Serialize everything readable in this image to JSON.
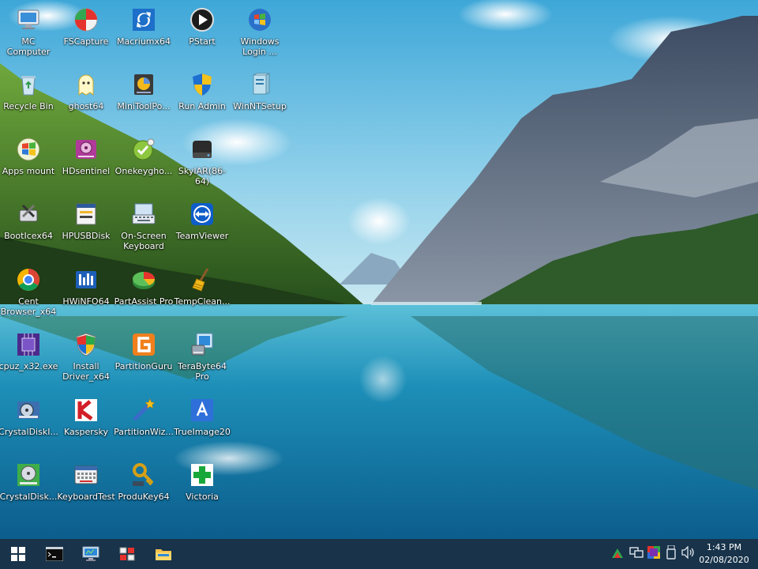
{
  "desktop": {
    "icons": [
      {
        "label": "MC\nComputer"
      },
      {
        "label": "FSCapture"
      },
      {
        "label": "Macriumx64"
      },
      {
        "label": "PStart"
      },
      {
        "label": "Windows\nLogin ..."
      },
      {
        "label": "Recycle Bin"
      },
      {
        "label": "ghost64"
      },
      {
        "label": "MiniToolPo..."
      },
      {
        "label": "Run Admin"
      },
      {
        "label": "WinNTSetup"
      },
      {
        "label": "Apps mount"
      },
      {
        "label": "HDsentinel"
      },
      {
        "label": "Onekeygho..."
      },
      {
        "label": "SkyIAR(86-64)"
      },
      {
        "label": "BootIcex64"
      },
      {
        "label": "HPUSBDisk"
      },
      {
        "label": "On-Screen\nKeyboard"
      },
      {
        "label": "TeamViewer"
      },
      {
        "label": "Cent\nBrowser_x64"
      },
      {
        "label": "HWiNFO64"
      },
      {
        "label": "PartAssist Pro"
      },
      {
        "label": "TempClean..."
      },
      {
        "label": "cpuz_x32.exe"
      },
      {
        "label": "Install\nDriver_x64"
      },
      {
        "label": "PartitionGuru"
      },
      {
        "label": "TeraByte64\nPro"
      },
      {
        "label": "CrystalDiskI..."
      },
      {
        "label": "Kaspersky"
      },
      {
        "label": "PartitionWiz..."
      },
      {
        "label": "TrueImage20"
      },
      {
        "label": "CrystalDisk..."
      },
      {
        "label": "KeyboardTest"
      },
      {
        "label": "ProduKey64"
      },
      {
        "label": "Victoria"
      }
    ]
  },
  "taskbar": {
    "start": {
      "icon": "windows-logo-icon"
    },
    "pinned": [
      {
        "name": "command-prompt",
        "icon": "console-icon"
      },
      {
        "name": "network-monitor",
        "icon": "monitor-icon"
      },
      {
        "name": "windows-tools",
        "icon": "tools-icon"
      },
      {
        "name": "file-explorer",
        "icon": "folder-icon"
      }
    ],
    "tray": {
      "icons": [
        "colors-icon",
        "network-icon",
        "display-color-icon",
        "usb-drive-icon",
        "volume-icon"
      ],
      "time": "1:43 PM",
      "date": "02/08/2020"
    }
  },
  "colors": {
    "taskbar": "#18334a",
    "label_text": "#ffffff"
  }
}
